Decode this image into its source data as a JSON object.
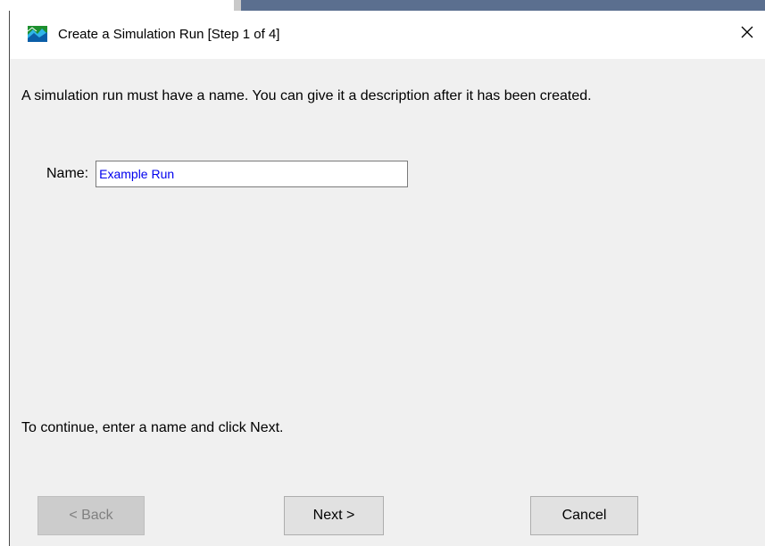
{
  "window": {
    "title": "Create a Simulation Run [Step 1 of 4]",
    "app_icon": "landscape-icon",
    "close_icon": "close-icon"
  },
  "content": {
    "instruction": "A simulation run must have a name. You can give it a description after it has been created.",
    "name_label": "Name:",
    "name_value": "Example Run",
    "hint": "To continue, enter a name and click Next."
  },
  "buttons": {
    "back_label": "< Back",
    "next_label": "Next >",
    "cancel_label": "Cancel"
  },
  "colors": {
    "input_text": "#0000ee",
    "dialog_bg": "#f0f0f0",
    "button_bg": "#e1e1e1",
    "disabled_button_bg": "#cccccc"
  }
}
